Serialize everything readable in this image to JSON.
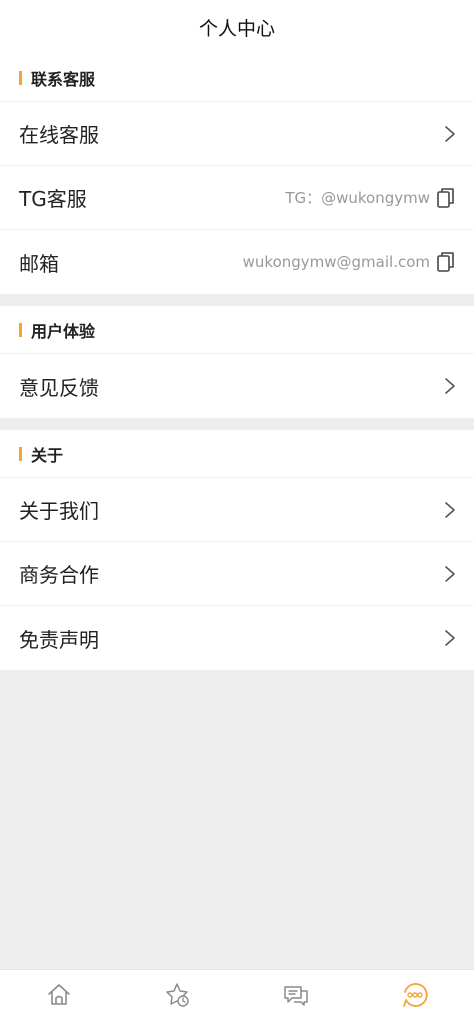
{
  "header": {
    "title": "个人中心"
  },
  "sections": [
    {
      "title": "联系客服",
      "rows": [
        {
          "label": "在线客服",
          "action": "chevron-right-icon"
        },
        {
          "label": "TG客服",
          "value": "TG：@wukongymw",
          "action": "copy-icon"
        },
        {
          "label": "邮箱",
          "value": "wukongymw@gmail.com",
          "action": "copy-icon"
        }
      ]
    },
    {
      "title": "用户体验",
      "rows": [
        {
          "label": "意见反馈",
          "action": "chevron-right-icon"
        }
      ]
    },
    {
      "title": "关于",
      "rows": [
        {
          "label": "关于我们",
          "action": "chevron-right-icon"
        },
        {
          "label": "商务合作",
          "action": "chevron-right-icon"
        },
        {
          "label": "免责声明",
          "action": "chevron-right-icon"
        }
      ]
    }
  ],
  "tabbar": {
    "items": [
      {
        "icon": "home-icon",
        "active": false
      },
      {
        "icon": "star-badge-icon",
        "active": false
      },
      {
        "icon": "chat-icon",
        "active": false
      },
      {
        "icon": "more-dots-icon",
        "active": true
      }
    ]
  },
  "colors": {
    "accent": "#f5a332",
    "background": "#eeeeee",
    "icon_inactive": "#8a8a8a"
  }
}
